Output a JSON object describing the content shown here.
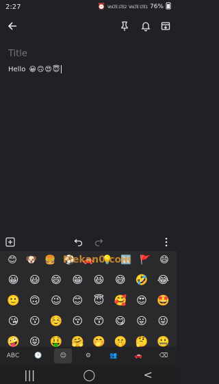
{
  "status": {
    "time": "2:27",
    "battery": "76%",
    "sig1": "VoLTE LTE2",
    "sig2": "VoLTE LTE1"
  },
  "note": {
    "title_placeholder": "Title",
    "body_text": "Hello",
    "body_emojis": [
      "😀",
      "🙃",
      "😍",
      "😇"
    ]
  },
  "keyboard": {
    "watermark": "Mekan0.com",
    "categories": [
      "😊",
      "🐶",
      "🍔",
      "⚽",
      "🚗",
      "💡",
      "🔣",
      "🚩",
      "😄"
    ],
    "emoji_rows": [
      [
        "😀",
        "😃",
        "😄",
        "😁",
        "😆",
        "😅",
        "🤣",
        "😂"
      ],
      [
        "🙂",
        "🙃",
        "😉",
        "😊",
        "😇",
        "🥰",
        "😍",
        "🤩"
      ],
      [
        "😘",
        "😗",
        "☺️",
        "😚",
        "😙",
        "😋",
        "😛",
        "😜"
      ],
      [
        "🤪",
        "😝",
        "🤑",
        "🤗",
        "🤭",
        "🤫",
        "🤔",
        "🤐"
      ]
    ],
    "bottom_keys": {
      "abc": "ABC",
      "recent": "🕒",
      "smileys": "😊",
      "settings": "⚙",
      "people": "👥",
      "car": "🚗",
      "delete": "⌫"
    }
  },
  "navbar": {
    "recents": "|||",
    "home": "◯",
    "back": "<"
  }
}
